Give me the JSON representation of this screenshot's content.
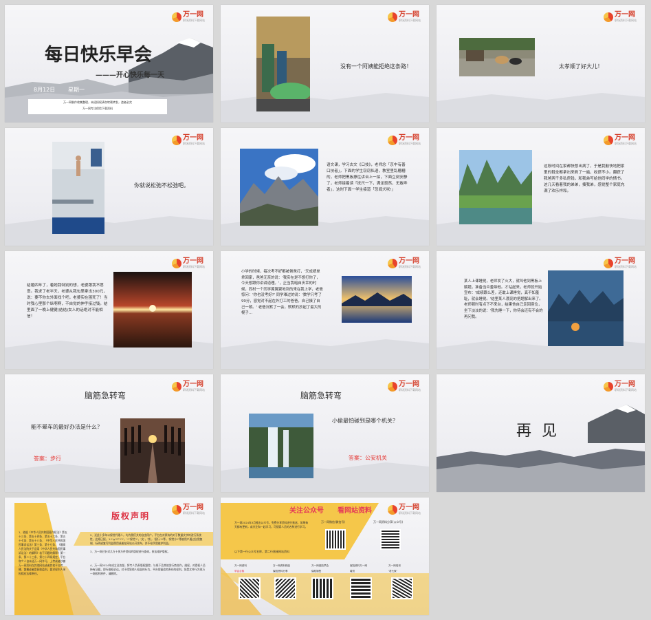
{
  "logo": {
    "name": "万一网",
    "tagline": "职场资料下载网站"
  },
  "slides": [
    {
      "id": 1,
      "title": "每日快乐早会",
      "subtitle": "———开心快乐每一天",
      "date": "8月12日",
      "weekday": "星期一",
      "footer1": "万一网制作收集整理，未经授权请勿转载转发，违者必究",
      "footer2": "万一网专注保险下载资料"
    },
    {
      "id": 2,
      "text": "没有一个阿姨能拒绝这条路！"
    },
    {
      "id": 3,
      "text": "太孝顺了好大儿！"
    },
    {
      "id": 4,
      "text": "你就说松弛不松弛吧。"
    },
    {
      "id": 5,
      "text": "语文课，学习古文《口技》，老师念「京中有善口技者」，下面的学生窃窃私语，教室里乱糟糟的，老师把黑板擦往讲台上一拍，下面立刻安静了，老师接着读「抚尺一下，满坐寂然，无敢哗者」，这时下面一学生接道「忽闻犬吠!」"
    },
    {
      "id": 6,
      "text": "这段时间在家都快憋出病了，于是我勤快地把家里的鞋全都拿出来刷了一遍，收获不小。翻获了我爸两千多私房钱，和我弟写给他同学的情书。这几天看着我的弟弟，揍我弟，感觉整个家庭充满了欢乐祥和。"
    },
    {
      "id": 7,
      "text": "结婚四年了，着她我特别的想，老婆跟我不愿意。我求了老半天，老婆从我包里拿出300元，说：要不你去外面找个吧，老婆实在困死了！当时我心里那个纵啊啊，不自觉的伸手接过钱。结里面了一晚上健健(结结)女人的话绝对不能相信！"
    },
    {
      "id": 8,
      "text": "小学的时候，每次考不好都被爸爸打，'天成绩单拿回家，爸爸无奈的说：'我实在是不想打你了，今天想跟你讲讲道理。'，正当我暗自庆幸的时候，同村一个同学翼翼翼地到的来在我上学，老爸惊问：'你也没考好?' 同学难过的说：'数学只考了99分，感觉对不起在外打工的爸爸，自己揍了自己一顿。' 老爸沉默了一会，默默的抄起了最大的棍子…"
    },
    {
      "id": 9,
      "text": "某人上课睡觉，老师发了火大，就叫他到黑板上解题，准备当众羞辱他。才站起来，老师就开始宣布：'成绩跟么差，还敢上课睡觉，真不知羞耻，就会睡觉。'结里某人漂亮的把题解出来了。老师顿时有点下不来台，结果他自己走回座位，坐下淡淡的说：'我先睡一下，你待会还有不会的再问我。"
    },
    {
      "id": 10,
      "title": "脑筋急转弯",
      "question": "能不晕车的最好办法是什么？",
      "answer": "答案：步行"
    },
    {
      "id": 11,
      "title": "脑筋急转弯",
      "question": "小偷最怕碰到是哪个机关？",
      "answer": "答案：公安机关"
    },
    {
      "id": 12,
      "title": "再 见"
    },
    {
      "id": 13,
      "title": "版权声明",
      "p1": "1、依据《中华人民共和国著作权法》第五十三条、第五十四条、第五十六条、第五十七条、第五十八条、《中华人民共和国民事诉讼法》第三条、第十七条、《最高人民法院关于适用〈中华人民共和国民事诉讼法〉的解释》若干问题的解释》第一条、第二十三条、第七十四条规定，平台和个人自未经万一网许可，上传或者抄袭万一网资料在其他网站或者其他平台传播、散播或者是获取盈利，要求权利人承担相应法律责任。",
      "p2": "2、近此十多年以保险代理人，均为我们关的自由用户，平台在对原有的对于数量文字的进行系统性，此规已报，'L'*'g'*'F'*'*'，'*''保险'*'，'女'，'钱'，'银行'**等，'保险小*'等被用户通过自我复制、标明或复写利益属用或者在网站公开发布，并不给予我维护利益。",
      "p3": "3、万一网已针对几万十多万件资料的版权进行查询，依法维护版权。",
      "p4": "4、万一网2024年成立法务部，将专人负责版权跟踪，与线下及其他发行商合作，维权，对侵权人员持有证据，即行维权诉讼。对于侵犯他人权益的行为，平台保留追究责任的权利。如是文件行为则万一网权利原件，请删除。"
    },
    {
      "id": 14,
      "title1": "关注公众号",
      "title2": "看网站资料",
      "intro": "万一网2024年3月推出公众号，免费分享资料进行推送，如果每天都有更新，或关注和一起学习，可搜索人员的名称进行学习。",
      "q1": "万一网微信(微信号)",
      "q2": "万一网资料分享(公众号)",
      "follow": "以下第一行公众号名称，第二行直接网站资料",
      "c1": "万一网资料",
      "c2": "万一网资料精品",
      "c3": "万一网保险早会",
      "c4": "保险资料万一网",
      "c5": "万一网培训",
      "d1": "早会合集",
      "d2": "保险资料分享",
      "d3": "保险销售",
      "d4": "增员",
      "d5": "'老七家'"
    }
  ]
}
